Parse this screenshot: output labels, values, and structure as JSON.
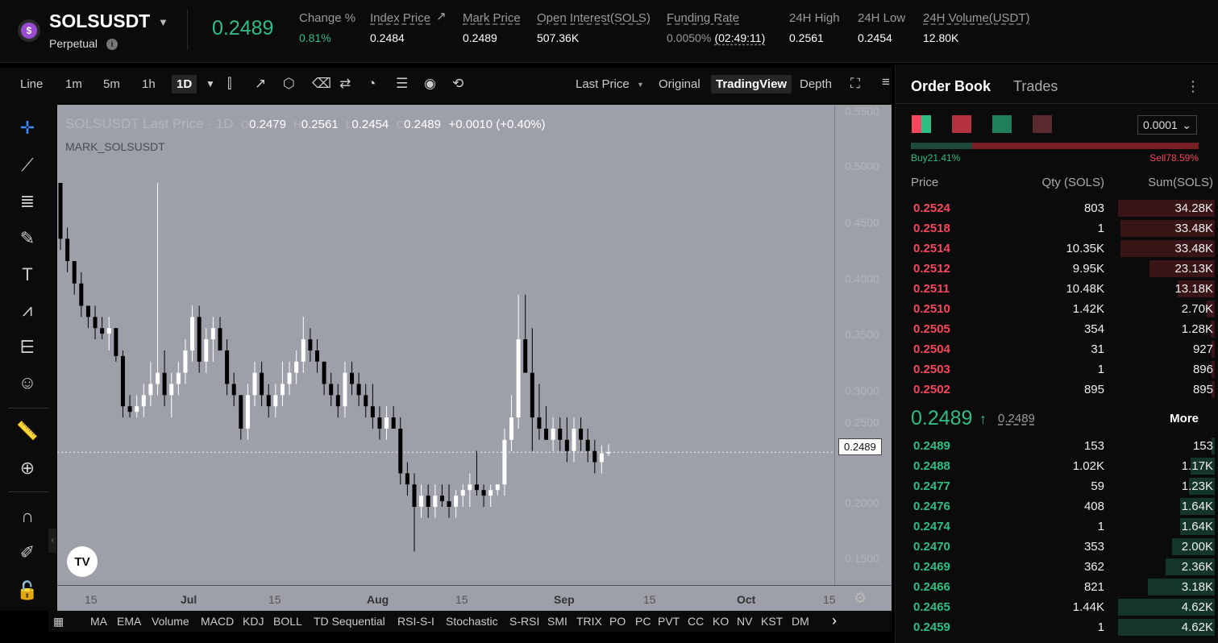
{
  "header": {
    "symbol": "SOLSUSDT",
    "caret": "▼",
    "type": "Perpetual",
    "info": "i",
    "last_price": "0.2489",
    "stats": [
      {
        "label": "Change %",
        "value": "0.81%"
      },
      {
        "label": "Index Price",
        "value": "0.2484"
      },
      {
        "label": "Mark Price",
        "value": "0.2489"
      },
      {
        "label": "Open Interest(SOLS)",
        "value": "507.36K"
      },
      {
        "label": "Funding Rate",
        "value": "0.0050%",
        "extra": "(02:49:11)"
      },
      {
        "label": "24H High",
        "value": "0.2561"
      },
      {
        "label": "24H Low",
        "value": "0.2454"
      },
      {
        "label": "24H Volume(USDT)",
        "value": "12.80K"
      }
    ]
  },
  "toolbar": {
    "intervals": [
      "Line",
      "1m",
      "5m",
      "1h",
      "1D"
    ],
    "active_interval": "1D",
    "price_type": "Last Price",
    "views": [
      "Original",
      "TradingView",
      "Depth"
    ],
    "active_view": "TradingView"
  },
  "chart": {
    "legend_title": "SOLSUSDT Last Price · 1D",
    "o": "0.2479",
    "h": "0.2561",
    "l": "0.2454",
    "c": "0.2489",
    "change": "+0.0010 (+0.40%)",
    "mark_series": "MARK_SOLSUSDT",
    "last_tag": "0.2489",
    "logo": "TV",
    "y_labels": [
      "0.5500",
      "0.5000",
      "0.4500",
      "0.4000",
      "0.3500",
      "0.3000",
      "0.2500",
      "0.2000",
      "0.1500"
    ],
    "x_labels": [
      "15",
      "Jul",
      "15",
      "Aug",
      "15",
      "Sep",
      "15",
      "Oct",
      "15"
    ]
  },
  "chart_data": {
    "type": "candlestick",
    "ylim": [
      0.13,
      0.56
    ],
    "candles": [
      [
        0.49,
        0.49,
        0.43,
        0.44
      ],
      [
        0.44,
        0.45,
        0.41,
        0.42
      ],
      [
        0.42,
        0.42,
        0.39,
        0.4
      ],
      [
        0.4,
        0.41,
        0.37,
        0.38
      ],
      [
        0.38,
        0.38,
        0.36,
        0.37
      ],
      [
        0.37,
        0.38,
        0.35,
        0.36
      ],
      [
        0.36,
        0.37,
        0.35,
        0.355
      ],
      [
        0.355,
        0.37,
        0.34,
        0.36
      ],
      [
        0.36,
        0.36,
        0.33,
        0.335
      ],
      [
        0.335,
        0.34,
        0.28,
        0.29
      ],
      [
        0.29,
        0.3,
        0.28,
        0.285
      ],
      [
        0.285,
        0.3,
        0.28,
        0.29
      ],
      [
        0.29,
        0.31,
        0.28,
        0.3
      ],
      [
        0.3,
        0.33,
        0.29,
        0.31
      ],
      [
        0.31,
        0.49,
        0.3,
        0.32
      ],
      [
        0.32,
        0.34,
        0.29,
        0.3
      ],
      [
        0.3,
        0.32,
        0.28,
        0.31
      ],
      [
        0.31,
        0.33,
        0.3,
        0.32
      ],
      [
        0.32,
        0.35,
        0.31,
        0.34
      ],
      [
        0.34,
        0.38,
        0.33,
        0.37
      ],
      [
        0.37,
        0.38,
        0.32,
        0.33
      ],
      [
        0.33,
        0.36,
        0.32,
        0.35
      ],
      [
        0.35,
        0.37,
        0.33,
        0.36
      ],
      [
        0.36,
        0.37,
        0.34,
        0.34
      ],
      [
        0.34,
        0.35,
        0.3,
        0.31
      ],
      [
        0.31,
        0.32,
        0.29,
        0.3
      ],
      [
        0.3,
        0.3,
        0.26,
        0.27
      ],
      [
        0.27,
        0.31,
        0.26,
        0.3
      ],
      [
        0.3,
        0.33,
        0.29,
        0.32
      ],
      [
        0.32,
        0.33,
        0.29,
        0.3
      ],
      [
        0.3,
        0.31,
        0.28,
        0.29
      ],
      [
        0.29,
        0.31,
        0.28,
        0.3
      ],
      [
        0.3,
        0.33,
        0.29,
        0.31
      ],
      [
        0.31,
        0.33,
        0.3,
        0.32
      ],
      [
        0.32,
        0.34,
        0.31,
        0.33
      ],
      [
        0.33,
        0.37,
        0.32,
        0.35
      ],
      [
        0.35,
        0.36,
        0.33,
        0.34
      ],
      [
        0.34,
        0.35,
        0.32,
        0.33
      ],
      [
        0.33,
        0.33,
        0.3,
        0.31
      ],
      [
        0.31,
        0.32,
        0.29,
        0.3
      ],
      [
        0.3,
        0.31,
        0.28,
        0.29
      ],
      [
        0.29,
        0.33,
        0.28,
        0.32
      ],
      [
        0.32,
        0.33,
        0.3,
        0.31
      ],
      [
        0.31,
        0.32,
        0.29,
        0.3
      ],
      [
        0.3,
        0.31,
        0.28,
        0.29
      ],
      [
        0.29,
        0.31,
        0.27,
        0.28
      ],
      [
        0.28,
        0.29,
        0.26,
        0.27
      ],
      [
        0.27,
        0.29,
        0.26,
        0.28
      ],
      [
        0.28,
        0.29,
        0.27,
        0.27
      ],
      [
        0.27,
        0.28,
        0.22,
        0.23
      ],
      [
        0.23,
        0.24,
        0.21,
        0.22
      ],
      [
        0.22,
        0.23,
        0.16,
        0.2
      ],
      [
        0.2,
        0.22,
        0.19,
        0.21
      ],
      [
        0.21,
        0.22,
        0.19,
        0.2
      ],
      [
        0.2,
        0.22,
        0.19,
        0.21
      ],
      [
        0.21,
        0.22,
        0.2,
        0.205
      ],
      [
        0.205,
        0.22,
        0.19,
        0.2
      ],
      [
        0.2,
        0.215,
        0.19,
        0.21
      ],
      [
        0.21,
        0.22,
        0.2,
        0.215
      ],
      [
        0.215,
        0.23,
        0.2,
        0.22
      ],
      [
        0.22,
        0.25,
        0.21,
        0.215
      ],
      [
        0.215,
        0.22,
        0.2,
        0.21
      ],
      [
        0.21,
        0.22,
        0.2,
        0.215
      ],
      [
        0.215,
        0.22,
        0.21,
        0.22
      ],
      [
        0.22,
        0.27,
        0.21,
        0.26
      ],
      [
        0.26,
        0.3,
        0.25,
        0.28
      ],
      [
        0.28,
        0.39,
        0.27,
        0.35
      ],
      [
        0.35,
        0.39,
        0.33,
        0.32
      ],
      [
        0.32,
        0.36,
        0.25,
        0.28
      ],
      [
        0.28,
        0.31,
        0.26,
        0.27
      ],
      [
        0.27,
        0.29,
        0.26,
        0.26
      ],
      [
        0.26,
        0.28,
        0.25,
        0.27
      ],
      [
        0.27,
        0.28,
        0.25,
        0.26
      ],
      [
        0.26,
        0.28,
        0.24,
        0.25
      ],
      [
        0.25,
        0.28,
        0.24,
        0.27
      ],
      [
        0.27,
        0.28,
        0.25,
        0.26
      ],
      [
        0.26,
        0.27,
        0.24,
        0.25
      ],
      [
        0.25,
        0.26,
        0.23,
        0.24
      ],
      [
        0.24,
        0.255,
        0.23,
        0.2479
      ],
      [
        0.2479,
        0.2561,
        0.2454,
        0.2489
      ]
    ]
  },
  "tools": [
    "crosshair",
    "trend-line",
    "horizontal-lines",
    "brush",
    "text",
    "pattern",
    "measure-lines",
    "emoji",
    "ruler",
    "zoom",
    "magnet",
    "lock-drawing",
    "unlock"
  ],
  "indicators": [
    "MA",
    "EMA",
    "Volume",
    "MACD",
    "KDJ",
    "BOLL",
    "TD Sequential",
    "RSI-S-I",
    "Stochastic",
    "S-RSI",
    "SMI",
    "TRIX",
    "PO",
    "PC",
    "PVT",
    "CC",
    "KO",
    "NV",
    "KST",
    "DM"
  ],
  "orderbook": {
    "tabs": [
      "Order Book",
      "Trades"
    ],
    "precision": "0.0001",
    "buy_label": "Buy21.41%",
    "sell_label": "Sell78.59%",
    "buy_pct": 21.41,
    "cols": [
      "Price",
      "Qty (SOLS)",
      "Sum(SOLS)"
    ],
    "asks": [
      [
        "0.2524",
        "803",
        "34.28K",
        1
      ],
      [
        "0.2518",
        "1",
        "33.48K",
        0.977
      ],
      [
        "0.2514",
        "10.35K",
        "33.48K",
        0.977
      ],
      [
        "0.2512",
        "9.95K",
        "23.13K",
        0.675
      ],
      [
        "0.2511",
        "10.48K",
        "13.18K",
        0.384
      ],
      [
        "0.2510",
        "1.42K",
        "2.70K",
        0.08
      ],
      [
        "0.2505",
        "354",
        "1.28K",
        0.04
      ],
      [
        "0.2504",
        "31",
        "927",
        0.03
      ],
      [
        "0.2503",
        "1",
        "896",
        0.03
      ],
      [
        "0.2502",
        "895",
        "895",
        0.03
      ]
    ],
    "mid_price": "0.2489",
    "mid_arrow": "↑",
    "mid_mark": "0.2489",
    "more": "More",
    "bids": [
      [
        "0.2489",
        "153",
        "153",
        0.03
      ],
      [
        "0.2488",
        "1.02K",
        "1.17K",
        0.25
      ],
      [
        "0.2477",
        "59",
        "1.23K",
        0.27
      ],
      [
        "0.2476",
        "408",
        "1.64K",
        0.36
      ],
      [
        "0.2474",
        "1",
        "1.64K",
        0.36
      ],
      [
        "0.2470",
        "353",
        "2.00K",
        0.44
      ],
      [
        "0.2469",
        "362",
        "2.36K",
        0.51
      ],
      [
        "0.2466",
        "821",
        "3.18K",
        0.69
      ],
      [
        "0.2465",
        "1.44K",
        "4.62K",
        1
      ],
      [
        "0.2459",
        "1",
        "4.62K",
        1
      ]
    ]
  }
}
